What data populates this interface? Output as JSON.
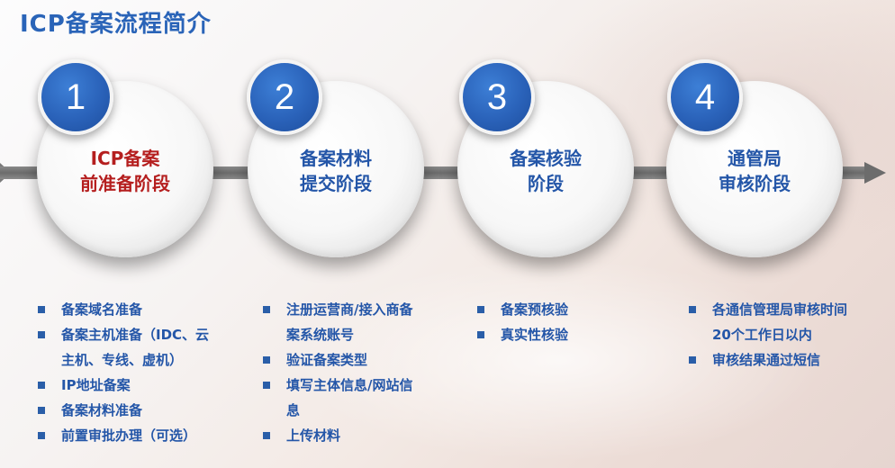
{
  "page_title": "ICP备案流程简介",
  "colors": {
    "title": "#2a64b8",
    "stage_text": "#2456a8",
    "stage_highlight": "#b51f1f",
    "badge": "#2a62b9",
    "timeline": "#6c6c6c"
  },
  "stages": [
    {
      "number": "1",
      "line1": "ICP备案",
      "line2": "前准备阶段",
      "bullets": [
        "备案域名准备",
        "备案主机准备（IDC、云主机、专线、虚机）",
        "IP地址备案",
        "备案材料准备",
        "前置审批办理（可选）"
      ]
    },
    {
      "number": "2",
      "line1": "备案材料",
      "line2": "提交阶段",
      "bullets": [
        "注册运营商/接入商备案系统账号",
        "验证备案类型",
        "填写主体信息/网站信息",
        "上传材料"
      ]
    },
    {
      "number": "3",
      "line1": "备案核验",
      "line2": "阶段",
      "bullets": [
        "备案预核验",
        "真实性核验"
      ]
    },
    {
      "number": "4",
      "line1": "通管局",
      "line2": "审核阶段",
      "bullets": [
        "各通信管理局审核时间20个工作日以内",
        "审核结果通过短信"
      ]
    }
  ]
}
